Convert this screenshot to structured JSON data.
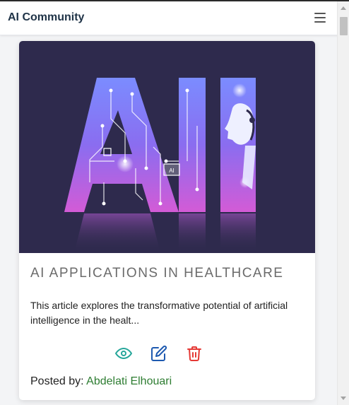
{
  "app": {
    "title": "AI Community"
  },
  "navbar": {
    "menu_icon": "hamburger-menu-icon"
  },
  "card": {
    "image_alt": "AI",
    "image_chip_text": "AI",
    "title": "AI APPLICATIONS IN HEALTHCARE",
    "excerpt": "This article explores the transformative potential of artificial intelligence in the healt...",
    "actions": [
      {
        "name": "view",
        "icon": "eye-icon",
        "color": "#26a69a"
      },
      {
        "name": "edit",
        "icon": "edit-icon",
        "color": "#1e5ab0"
      },
      {
        "name": "delete",
        "icon": "trash-icon",
        "color": "#e53935"
      }
    ],
    "posted_label": "Posted by:",
    "author": "Abdelati Elhouari"
  },
  "colors": {
    "brand_text": "#1f3347",
    "author": "#2e7d32",
    "image_bg": "#2e2a4d",
    "view": "#26a69a",
    "edit": "#1e5ab0",
    "delete": "#e53935"
  }
}
